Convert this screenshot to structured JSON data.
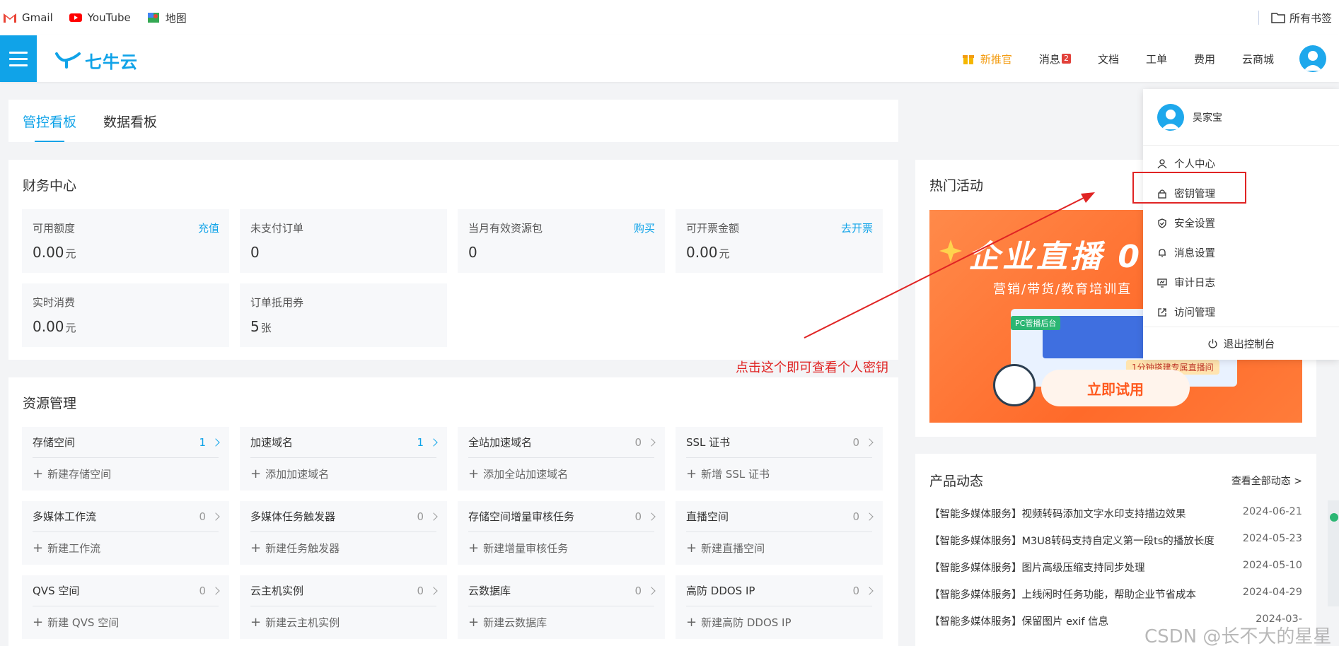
{
  "bookmarks": {
    "items": [
      {
        "label": "Gmail",
        "icon": "gmail-icon"
      },
      {
        "label": "YouTube",
        "icon": "youtube-icon"
      },
      {
        "label": "地图",
        "icon": "maps-icon"
      }
    ],
    "all_bookmarks": "所有书签"
  },
  "nav": {
    "logo": "七牛云",
    "links": {
      "promo": "新推官",
      "messages": "消息",
      "message_count": "2",
      "docs": "文档",
      "tickets": "工单",
      "billing": "费用",
      "store": "云商城"
    }
  },
  "tabs": [
    "管控看板",
    "数据看板"
  ],
  "finance": {
    "title": "财务中心",
    "items": [
      {
        "label": "可用额度",
        "action": "充值",
        "value": "0.00",
        "unit": "元"
      },
      {
        "label": "未支付订单",
        "action": "",
        "value": "0",
        "unit": ""
      },
      {
        "label": "当月有效资源包",
        "action": "购买",
        "value": "0",
        "unit": ""
      },
      {
        "label": "可开票金额",
        "action": "去开票",
        "value": "0.00",
        "unit": "元"
      },
      {
        "label": "实时消费",
        "action": "",
        "value": "0.00",
        "unit": "元"
      },
      {
        "label": "订单抵用券",
        "action": "",
        "value": "5",
        "unit": "张"
      }
    ]
  },
  "resources": {
    "title": "资源管理",
    "items": [
      {
        "name": "存储空间",
        "count": "1",
        "add": "新建存储空间"
      },
      {
        "name": "加速域名",
        "count": "1",
        "add": "添加加速域名"
      },
      {
        "name": "全站加速域名",
        "count": "0",
        "add": "添加全站加速域名"
      },
      {
        "name": "SSL 证书",
        "count": "0",
        "add": "新增 SSL 证书"
      },
      {
        "name": "多媒体工作流",
        "count": "0",
        "add": "新建工作流"
      },
      {
        "name": "多媒体任务触发器",
        "count": "0",
        "add": "新建任务触发器"
      },
      {
        "name": "存储空间增量审核任务",
        "count": "0",
        "add": "新建增量审核任务"
      },
      {
        "name": "直播空间",
        "count": "0",
        "add": "新建直播空间"
      },
      {
        "name": "QVS 空间",
        "count": "0",
        "add": "新建 QVS 空间"
      },
      {
        "name": "云主机实例",
        "count": "0",
        "add": "新建云主机实例"
      },
      {
        "name": "云数据库",
        "count": "0",
        "add": "新建云数据库"
      },
      {
        "name": "高防 DDOS IP",
        "count": "0",
        "add": "新建高防 DDOS IP"
      }
    ]
  },
  "hot": {
    "title": "热门活动",
    "banner_title": "企业直播 0",
    "banner_sub": "营销/带货/教育培训直",
    "banner_button": "立即试用",
    "banner_tag": "1分钟搭建专属直播间",
    "banner_pc": "PC管播后台"
  },
  "news": {
    "title": "产品动态",
    "more": "查看全部动态 >",
    "items": [
      {
        "text": "【智能多媒体服务】视频转码添加文字水印支持描边效果",
        "date": "2024-06-21"
      },
      {
        "text": "【智能多媒体服务】M3U8转码支持自定义第一段ts的播放长度",
        "date": "2024-05-23"
      },
      {
        "text": "【智能多媒体服务】图片高级压缩支持同步处理",
        "date": "2024-05-10"
      },
      {
        "text": "【智能多媒体服务】上线闲时任务功能，帮助企业节省成本",
        "date": "2024-04-29"
      },
      {
        "text": "【智能多媒体服务】保留图片 exif 信息",
        "date": "2024-03-"
      }
    ]
  },
  "dropdown": {
    "user": "吴家宝",
    "items": [
      "个人中心",
      "密钥管理",
      "安全设置",
      "消息设置",
      "审计日志",
      "访问管理"
    ],
    "logout": "退出控制台"
  },
  "annotation": "点击这个即可查看个人密钥",
  "watermark": "CSDN @长不大的星星",
  "colors": {
    "accent": "#10a3e8",
    "promo": "#f39c12",
    "annotation": "#e02424",
    "banner": "#ff7a35"
  }
}
